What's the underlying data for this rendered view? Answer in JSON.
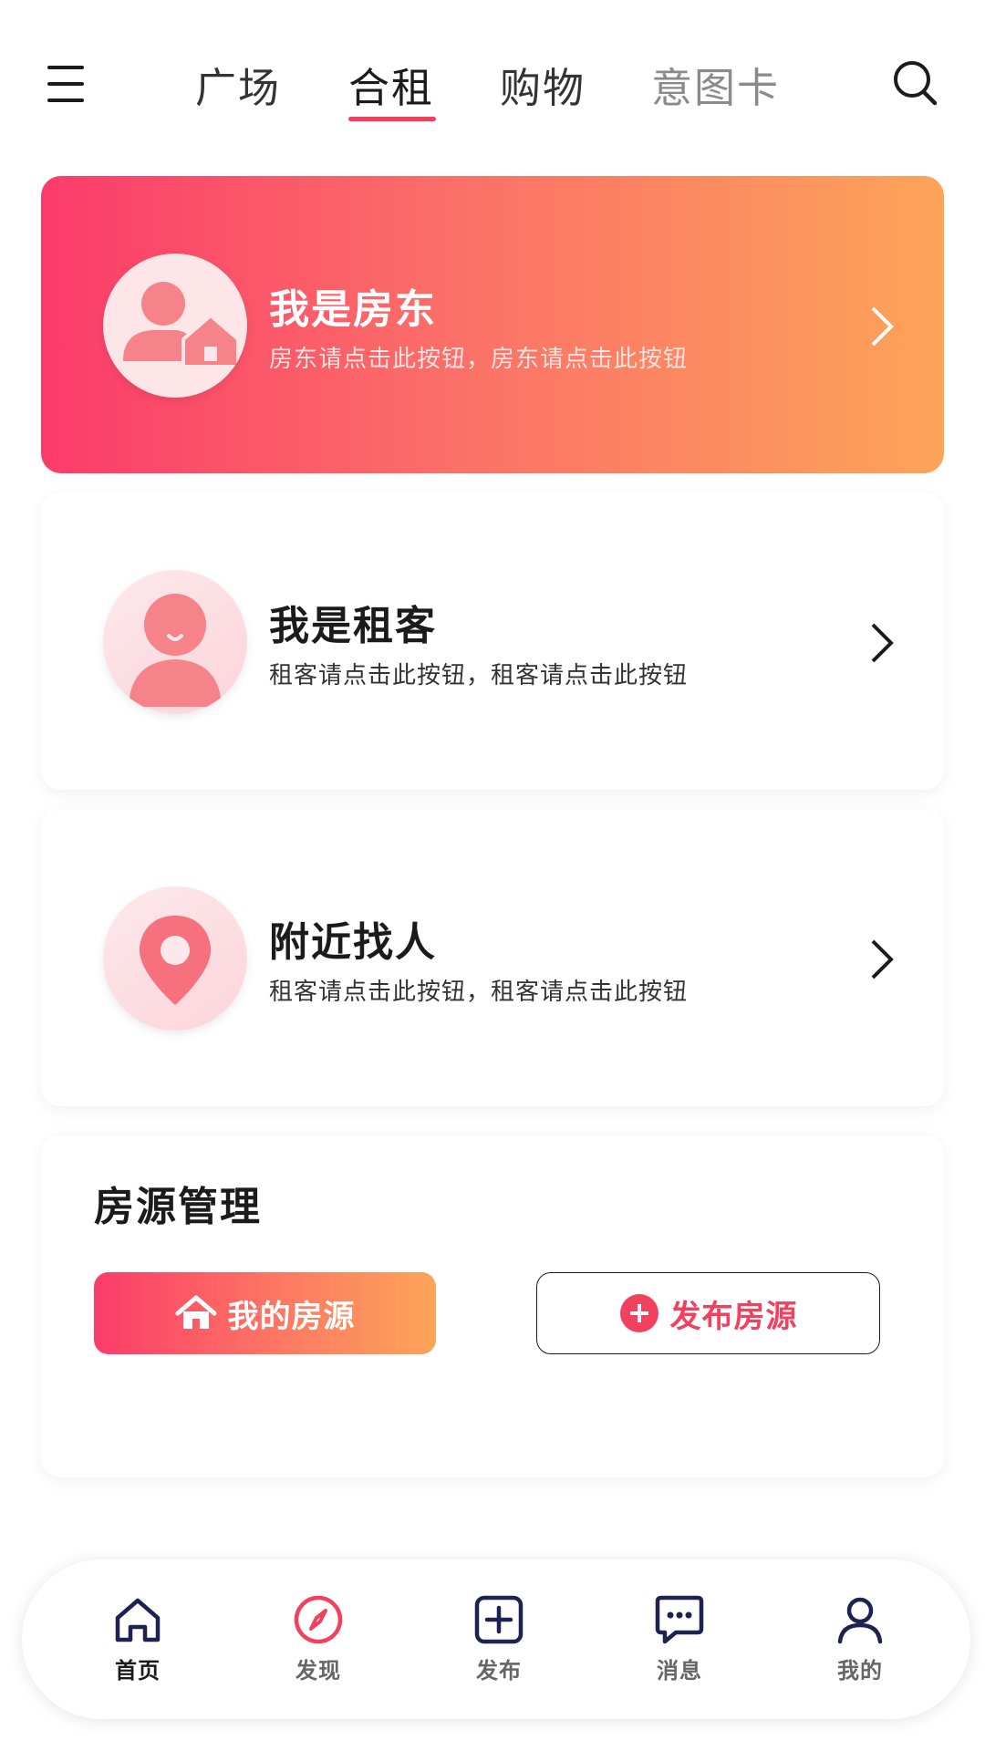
{
  "header": {
    "tabs": [
      {
        "label": "广场"
      },
      {
        "label": "合租"
      },
      {
        "label": "购物"
      },
      {
        "label": "意图卡"
      }
    ],
    "active_tab": "合租",
    "menu_icon": "hamburger-menu-icon",
    "search_icon": "search-icon"
  },
  "cards": {
    "landlord": {
      "title": "我是房东",
      "subtitle": "房东请点击此按钮，房东请点击此按钮",
      "icon": "landlord-house-icon"
    },
    "tenant": {
      "title": "我是租客",
      "subtitle": "租客请点击此按钮，租客请点击此按钮",
      "icon": "tenant-person-icon"
    },
    "nearby": {
      "title": "附近找人",
      "subtitle": "租客请点击此按钮，租客请点击此按钮",
      "icon": "location-pin-icon"
    }
  },
  "manage": {
    "title": "房源管理",
    "my_listings": "我的房源",
    "publish_listing": "发布房源"
  },
  "bottom_nav": {
    "items": [
      {
        "label": "首页",
        "icon": "home-icon"
      },
      {
        "label": "发现",
        "icon": "compass-icon"
      },
      {
        "label": "发布",
        "icon": "plus-square-icon"
      },
      {
        "label": "消息",
        "icon": "message-icon"
      },
      {
        "label": "我的",
        "icon": "user-icon"
      }
    ],
    "active": "首页"
  },
  "colors": {
    "accent": "#f2415e",
    "gradient_start": "#fb3b6a",
    "gradient_end": "#fda459",
    "nav_icon": "#1e2250"
  }
}
